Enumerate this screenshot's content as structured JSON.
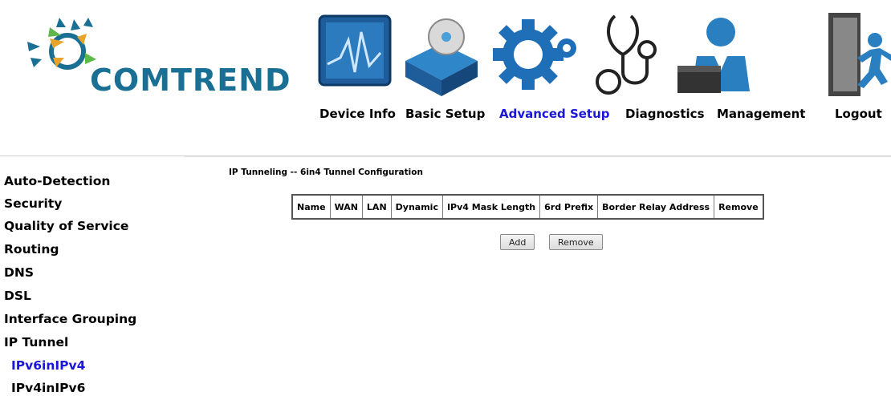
{
  "brand": {
    "name": "COMTREND"
  },
  "nav": [
    {
      "label": "Device Info",
      "icon": "device-info-icon",
      "active": false
    },
    {
      "label": "Basic Setup",
      "icon": "basic-setup-icon",
      "active": false
    },
    {
      "label": "Advanced Setup",
      "icon": "advanced-setup-icon",
      "active": true
    },
    {
      "label": "Diagnostics",
      "icon": "stethoscope-icon",
      "active": false
    },
    {
      "label": "Management",
      "icon": "management-icon",
      "active": false
    },
    {
      "label": "Logout",
      "icon": "logout-icon",
      "active": false
    }
  ],
  "sidebar": {
    "items": [
      {
        "label": "Auto-Detection"
      },
      {
        "label": "Security"
      },
      {
        "label": "Quality of Service"
      },
      {
        "label": "Routing"
      },
      {
        "label": "DNS"
      },
      {
        "label": "DSL"
      },
      {
        "label": "Interface Grouping"
      },
      {
        "label": "IP Tunnel"
      }
    ],
    "subitems": [
      {
        "label": "IPv6inIPv4",
        "active": true
      },
      {
        "label": "IPv4inIPv6",
        "active": false
      }
    ]
  },
  "main": {
    "title": "IP Tunneling -- 6in4 Tunnel Configuration",
    "table": {
      "columns": [
        "Name",
        "WAN",
        "LAN",
        "Dynamic",
        "IPv4 Mask Length",
        "6rd Prefix",
        "Border Relay Address",
        "Remove"
      ]
    },
    "buttons": {
      "add": "Add",
      "remove": "Remove"
    }
  },
  "colors": {
    "brand": "#1a6f94",
    "active_link": "#1b17d8"
  }
}
